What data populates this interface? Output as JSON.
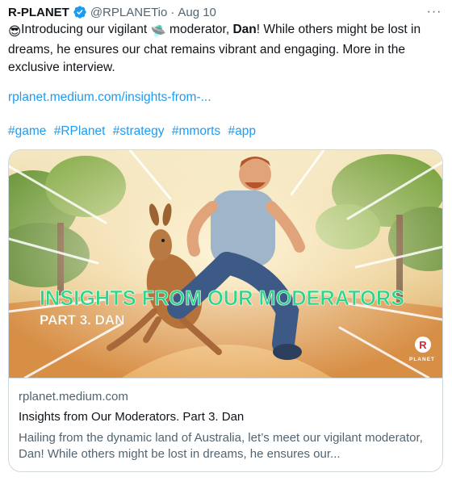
{
  "author": {
    "name": "R-PLANET",
    "handle": "@RPLANETio",
    "separator": "·",
    "date": "Aug 10"
  },
  "tweet": {
    "emoji_1": "😎",
    "text_1": "Introducing our vigilant ",
    "emoji_2": "🛸",
    "text_2": " moderator, ",
    "bold_name": "Dan",
    "text_3": "! While others might be lost in dreams, he ensures our chat remains vibrant and engaging. More in the exclusive interview.",
    "link": "rplanet.medium.com/insights-from-...",
    "hashtags": [
      "#game",
      "#RPlanet",
      "#strategy",
      "#mmorts",
      "#app"
    ]
  },
  "card": {
    "banner_title": "INSIGHTS FROM OUR MODERATORS",
    "banner_subtitle": "PART 3. DAN",
    "logo_letter": "R",
    "logo_text": "PLANET",
    "domain": "rplanet.medium.com",
    "title": "Insights from Our Moderators. Part 3. Dan",
    "description": "Hailing from the dynamic land of Australia, let’s meet our vigilant moderator, Dan! While others might be lost in dreams, he ensures our..."
  },
  "colors": {
    "link": "#1d9bf0",
    "verified": "#1d9bf0",
    "banner_title": "#2fd48a",
    "banner_subtitle": "#ffffff",
    "logo_red": "#d9262e"
  },
  "icons": {
    "verified": "verified-badge-icon",
    "more": "more-horizontal-icon"
  },
  "more_label": "···"
}
